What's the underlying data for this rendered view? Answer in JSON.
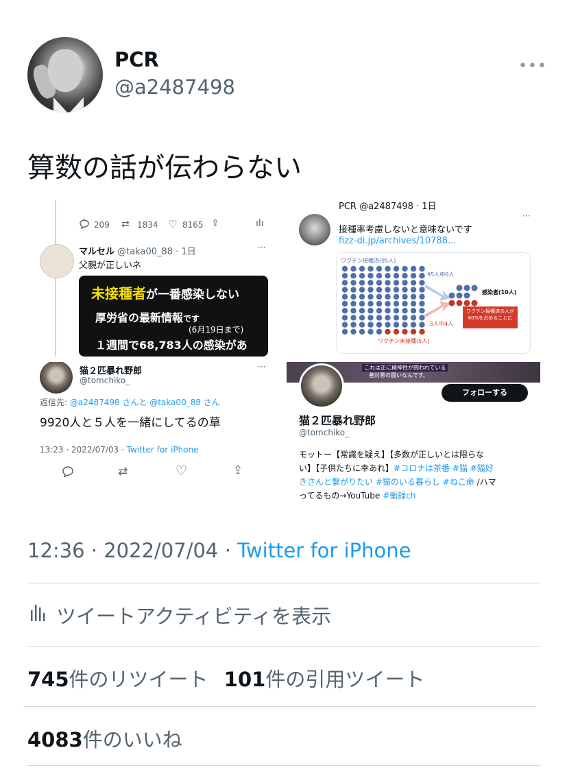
{
  "author": {
    "name": "PCR",
    "handle": "@a2487498",
    "more_label": "•••"
  },
  "tweet": {
    "text": "算数の話が伝わらない"
  },
  "collage": {
    "p1": {
      "stats": {
        "replies": "209",
        "retweets": "1834",
        "likes": "8165"
      },
      "user": "マルセル",
      "handle": "@taka00_88",
      "time": "· 1日",
      "text": "父親が正しいネ",
      "card_line1a": "未接種者",
      "card_line1b": "が一番感染しない",
      "card_line2a": "厚労省の最新情報",
      "card_line2b": "です",
      "card_line3": "(6月19日まで)",
      "card_line4": "１週間で68,783人の感染があ"
    },
    "p2": {
      "header": "PCR @a2487498 · 1日",
      "text": "接種率考慮しないと意味ないです",
      "link": "fizz-di.jp/archives/10788...",
      "vaccinated_label": "ワクチン接種済(95人)",
      "unvaccinated_label": "ワクチン未接種(5人)",
      "arrow_top": "95人中6人",
      "arrow_bottom": "5人中4人",
      "infected_label": "感染者(10人)",
      "note": "ワクチン接種済の人が60%を占めることに"
    },
    "p3": {
      "user": "猫２匹暴れ野郎",
      "handle": "@tomchiko_",
      "reply_prefix": "返信先: ",
      "reply_to": "@a2487498 さんと @taka00_88 さん",
      "text": "9920人と５人を一緒にしてるの草",
      "time": "13:23 · 2022/07/03 · ",
      "via": "Twitter for iPhone"
    },
    "p4": {
      "banner_text1": "これは正に精神性が問われている",
      "banner_text2": "善対悪の闘いなんです。",
      "follow_label": "フォローする",
      "user": "猫２匹暴れ野郎",
      "handle": "@tomchiko_",
      "bio1": "モットー【常識を疑え】【多数が正しいとは限らな",
      "bio2": "い】【子供たちに幸あれ】",
      "bio2_tags": "#コロナは茶番 #猫 #猫好",
      "bio3_tags": "きさんと繋がりたい #猫のいる暮らし #ねこ命",
      "bio3_rest": " /ハマ",
      "bio4": "ってるもの→YouTube ",
      "bio4_tag": "#衝録ch"
    }
  },
  "meta": {
    "time": "12:36 · 2022/07/04 · ",
    "source": "Twitter for iPhone"
  },
  "activity_label": "ツイートアクティビティを表示",
  "counts": {
    "retweets": "745",
    "retweets_label": "件のリツイート",
    "quotes": "101",
    "quotes_label": "件の引用ツイート",
    "likes": "4083",
    "likes_label": "件のいいね"
  },
  "colors": {
    "link": "#1d9bf0",
    "secondary": "#536471",
    "vaccinated_dot": "#4f6fa8",
    "unvaccinated_dot": "#c0392b"
  }
}
